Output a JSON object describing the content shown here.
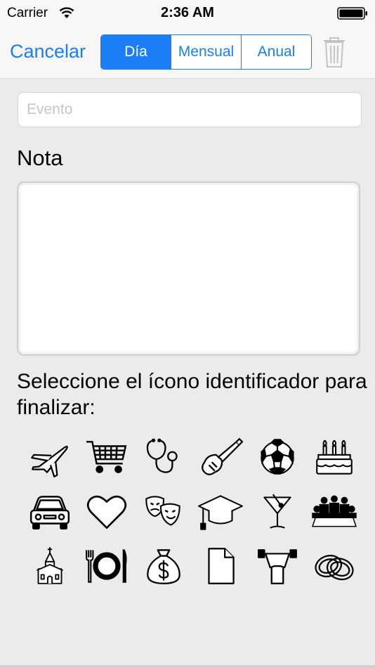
{
  "status_bar": {
    "carrier": "Carrier",
    "time": "2:36 AM",
    "wifi_icon": "wifi-icon",
    "battery_icon": "battery-icon"
  },
  "nav": {
    "cancel_label": "Cancelar",
    "segments": [
      "Día",
      "Mensual",
      "Anual"
    ],
    "selected_segment": "Día",
    "trash_icon": "trash-icon",
    "accent_color": "#1a7ef5"
  },
  "form": {
    "event_placeholder": "Evento",
    "event_value": "",
    "note_label": "Nota",
    "note_value": "",
    "select_icon_label": "Seleccione el ícono identificador para finalizar:"
  },
  "icons": [
    "airplane-icon",
    "shopping-cart-icon",
    "stethoscope-icon",
    "electric-guitar-icon",
    "soccer-ball-icon",
    "birthday-cake-icon",
    "car-icon",
    "heart-icon",
    "theater-masks-icon",
    "graduation-cap-icon",
    "cocktail-glass-icon",
    "meeting-table-icon",
    "church-icon",
    "plate-cutlery-icon",
    "money-bag-icon",
    "document-icon",
    "weightlifter-icon",
    "wedding-rings-icon"
  ]
}
